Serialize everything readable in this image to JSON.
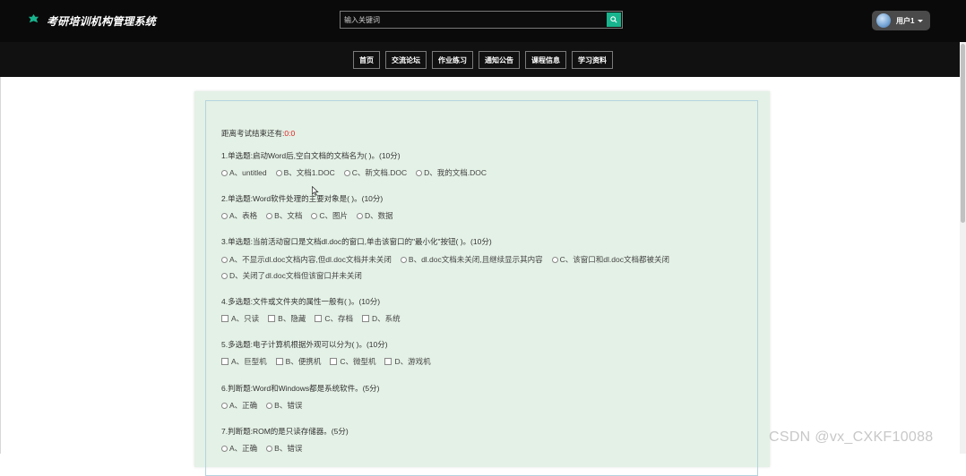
{
  "header": {
    "app_title": "考研培训机构管理系统",
    "search_placeholder": "输入关键词",
    "user_name": "用户1"
  },
  "nav": [
    "首页",
    "交流论坛",
    "作业练习",
    "通知公告",
    "课程信息",
    "学习资料"
  ],
  "exam": {
    "timer_label": "距离考试结束还有:",
    "timer_value": "0:0",
    "questions": [
      {
        "title": "1.单选题:启动Word后,空白文档的文档名为(    )。(10分)",
        "type": "radio",
        "options": [
          "A、untitled",
          "B、文档1.DOC",
          "C、新文档.DOC",
          "D、我的文档.DOC"
        ]
      },
      {
        "title": "2.单选题:Word软件处理的主要对象是(    )。(10分)",
        "type": "radio",
        "options": [
          "A、表格",
          "B、文档",
          "C、图片",
          "D、数据"
        ]
      },
      {
        "title": "3.单选题:当前活动窗口是文档dl.doc的窗口,单击该窗口的\"最小化\"按钮(    )。(10分)",
        "type": "radio",
        "options": [
          "A、不显示dl.doc文档内容,但dl.doc文档并未关闭",
          "B、dl.doc文档未关闭,且继续显示其内容",
          "C、该窗口和dl.doc文档都被关闭",
          "D、关闭了dl.doc文档但该窗口并未关闭"
        ]
      },
      {
        "title": "4.多选题:文件或文件夹的属性一般有(    )。(10分)",
        "type": "checkbox",
        "options": [
          "A、只读",
          "B、隐藏",
          "C、存档",
          "D、系统"
        ]
      },
      {
        "title": "5.多选题:电子计算机根据外观可以分为(    )。(10分)",
        "type": "checkbox",
        "options": [
          "A、巨型机",
          "B、便携机",
          "C、微型机",
          "D、游戏机"
        ]
      },
      {
        "title": "6.判断题:Word和Windows都是系统软件。(5分)",
        "type": "radio",
        "options": [
          "A、正确",
          "B、错误"
        ]
      },
      {
        "title": "7.判断题:ROM的是只读存储器。(5分)",
        "type": "radio",
        "options": [
          "A、正确",
          "B、错误"
        ]
      }
    ]
  },
  "watermark": "CSDN @vx_CXKF10088",
  "colors": {
    "accent": "#18b48e",
    "timer": "#e02020",
    "card_bg": "#e4f1e6",
    "header_bg": "#0a0a0a"
  }
}
